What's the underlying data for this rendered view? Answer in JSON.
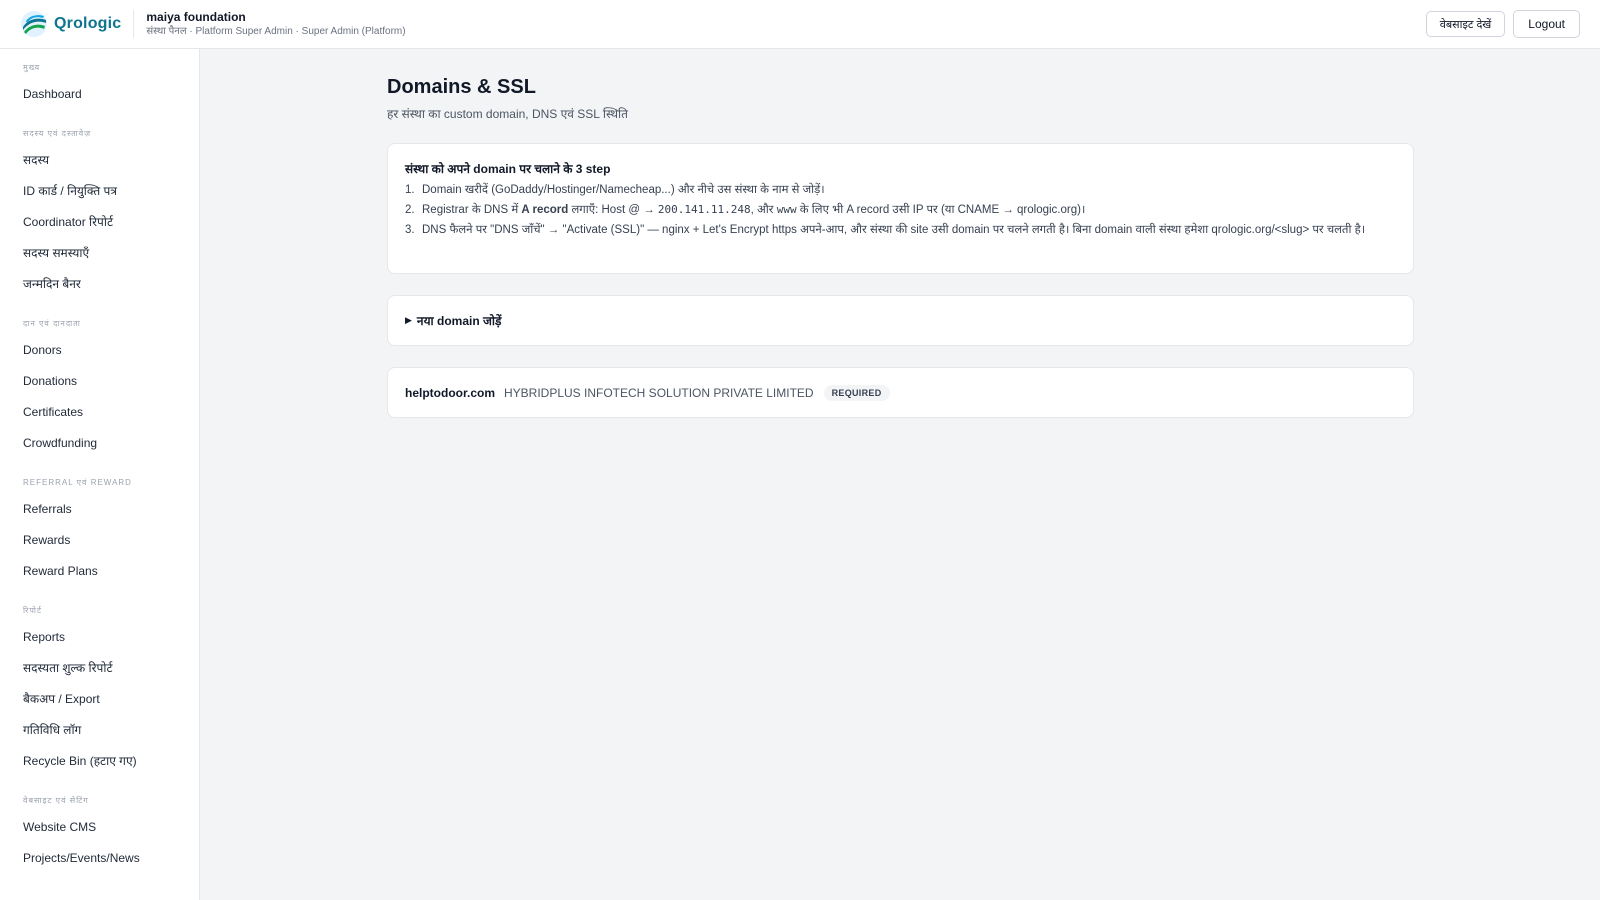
{
  "header": {
    "brand_name": "Qrologic",
    "org_name": "maiya foundation",
    "org_subtitle": "संस्था पैनल · Platform Super Admin · Super Admin (Platform)",
    "view_website_label": "वेबसाइट देखें",
    "logout_label": "Logout"
  },
  "sidebar": {
    "groups": [
      {
        "heading": "मुख्य",
        "items": [
          "Dashboard"
        ]
      },
      {
        "heading": "सदस्य एवं दस्तावेज़",
        "items": [
          "सदस्य",
          "ID कार्ड / नियुक्ति पत्र",
          "Coordinator रिपोर्ट",
          "सदस्य समस्याएँ",
          "जन्मदिन बैनर"
        ]
      },
      {
        "heading": "दान एवं दानदाता",
        "items": [
          "Donors",
          "Donations",
          "Certificates",
          "Crowdfunding"
        ]
      },
      {
        "heading": "Referral एवं Reward",
        "items": [
          "Referrals",
          "Rewards",
          "Reward Plans"
        ]
      },
      {
        "heading": "रिपोर्ट",
        "items": [
          "Reports",
          "सदस्यता शुल्क रिपोर्ट",
          "बैकअप / Export",
          "गतिविधि लॉग",
          "Recycle Bin (हटाए गए)"
        ]
      },
      {
        "heading": "वेबसाइट एवं सेटिंग",
        "items": [
          "Website CMS",
          "Projects/Events/News"
        ]
      }
    ]
  },
  "page": {
    "title": "Domains & SSL",
    "subtitle": "हर संस्था का custom domain, DNS एवं SSL स्थिति"
  },
  "steps": {
    "title": "संस्था को अपने domain पर चलाने के 3 step",
    "items": [
      {
        "num": "1.",
        "text": "Domain खरीदें (GoDaddy/Hostinger/Namecheap...) और नीचे उस संस्था के नाम से जोड़ें।"
      },
      {
        "num": "2.",
        "pre": "Registrar के DNS में ",
        "bold": "A record",
        "mid": " लगाएँ: Host ",
        "host": "@",
        "arrow": " → ",
        "ip": "200.141.11.248",
        "post": ", और ",
        "www": "www",
        "tail": " के लिए भी A record उसी IP पर (या CNAME → qrologic.org)।"
      },
      {
        "num": "3.",
        "text": "DNS फैलने पर \"DNS जाँचें\" → \"Activate (SSL)\" — nginx + Let's Encrypt https अपने-आप, और संस्था की site उसी domain पर चलने लगती है। बिना domain वाली संस्था हमेशा qrologic.org/<slug> पर चलती है।"
      }
    ]
  },
  "add_domain": {
    "arrow": "▶",
    "label": "नया domain जोड़ें"
  },
  "domains": [
    {
      "domain": "helptodoor.com",
      "org": "HYBRIDPLUS INFOTECH SOLUTION PRIVATE LIMITED",
      "status": "REQUIRED"
    }
  ],
  "colors": {
    "brand": "#0e7490",
    "background": "#f3f4f6",
    "card": "#ffffff",
    "border": "#e5e7eb"
  }
}
